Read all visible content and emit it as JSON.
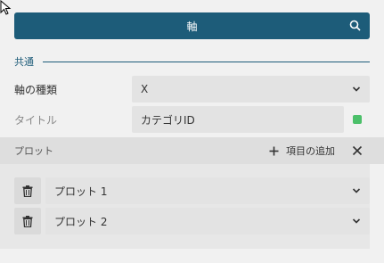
{
  "header": {
    "title": "軸",
    "search_icon": "search-icon"
  },
  "common_section": {
    "label": "共通"
  },
  "axis_type": {
    "label": "軸の種類",
    "value": "X"
  },
  "title_field": {
    "label": "タイトル",
    "value": "カテゴリID",
    "color": "#4cc06a"
  },
  "plot_section": {
    "title": "プロット",
    "add_label": "項目の追加"
  },
  "plots": [
    {
      "label": "プロット 1"
    },
    {
      "label": "プロット 2"
    }
  ],
  "colors": {
    "accent": "#1d5c79",
    "swatch": "#4cc06a"
  }
}
